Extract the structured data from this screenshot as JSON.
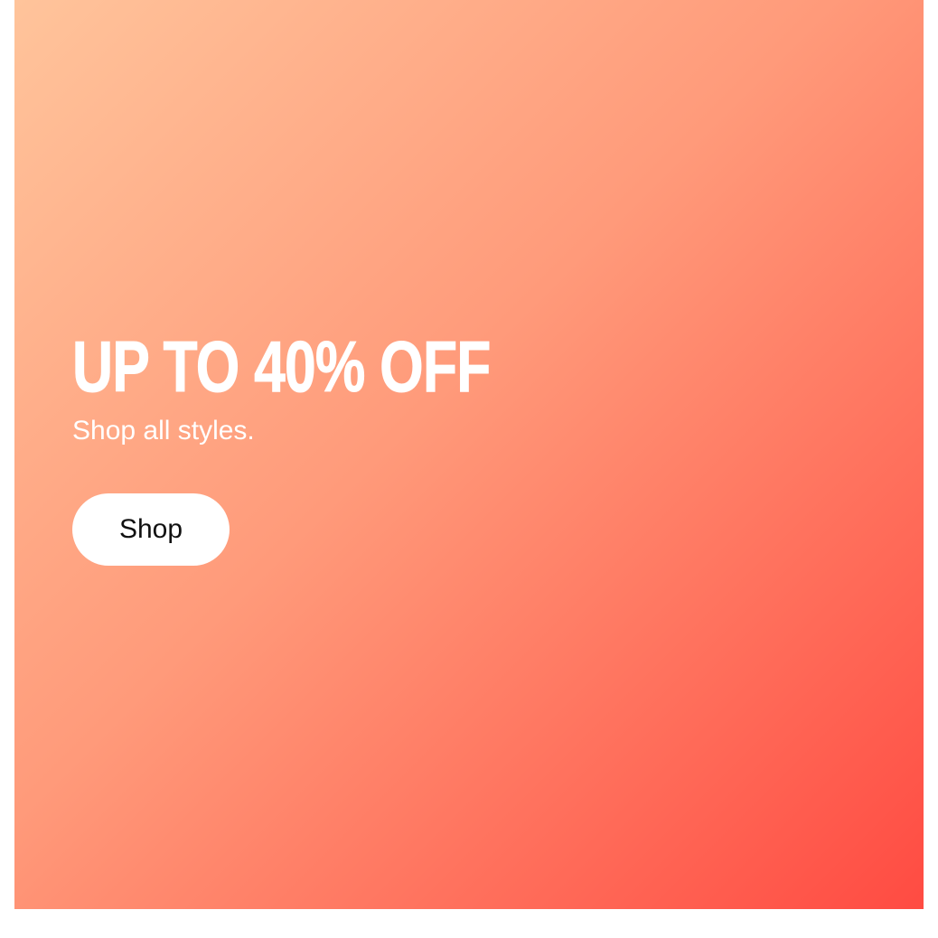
{
  "banner": {
    "headline": "UP TO 40% OFF",
    "subhead": "Shop all styles.",
    "cta_label": "Shop",
    "gradient_start": "#ffc49b",
    "gradient_end": "#ff4b42",
    "text_color": "#ffffff",
    "button_bg": "#ffffff",
    "button_text_color": "#111111"
  }
}
